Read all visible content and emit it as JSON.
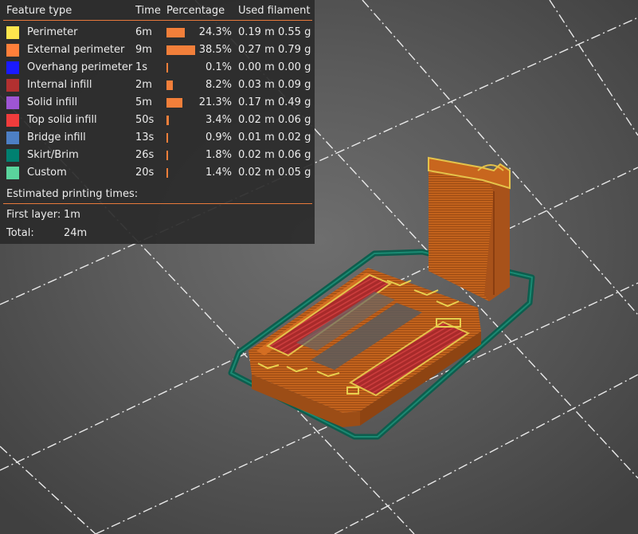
{
  "legend": {
    "headers": {
      "feature": "Feature type",
      "time": "Time",
      "percentage": "Percentage",
      "filament": "Used filament"
    },
    "rows": [
      {
        "label": "Perimeter",
        "color": "#ffe64d",
        "time": "6m",
        "percent": 24.3,
        "percent_text": "24.3%",
        "length": "0.19 m",
        "weight": "0.55 g"
      },
      {
        "label": "External perimeter",
        "color": "#ff7f3a",
        "time": "9m",
        "percent": 38.5,
        "percent_text": "38.5%",
        "length": "0.27 m",
        "weight": "0.79 g"
      },
      {
        "label": "Overhang perimeter",
        "color": "#1a1aff",
        "time": "1s",
        "percent": 0.1,
        "percent_text": "0.1%",
        "length": "0.00 m",
        "weight": "0.00 g"
      },
      {
        "label": "Internal infill",
        "color": "#b23030",
        "time": "2m",
        "percent": 8.2,
        "percent_text": "8.2%",
        "length": "0.03 m",
        "weight": "0.09 g"
      },
      {
        "label": "Solid infill",
        "color": "#9e55d4",
        "time": "5m",
        "percent": 21.3,
        "percent_text": "21.3%",
        "length": "0.17 m",
        "weight": "0.49 g"
      },
      {
        "label": "Top solid infill",
        "color": "#f03c3c",
        "time": "50s",
        "percent": 3.4,
        "percent_text": "3.4%",
        "length": "0.02 m",
        "weight": "0.06 g"
      },
      {
        "label": "Bridge infill",
        "color": "#4d7fc4",
        "time": "13s",
        "percent": 0.9,
        "percent_text": "0.9%",
        "length": "0.01 m",
        "weight": "0.02 g"
      },
      {
        "label": "Skirt/Brim",
        "color": "#008070",
        "time": "26s",
        "percent": 1.8,
        "percent_text": "1.8%",
        "length": "0.02 m",
        "weight": "0.06 g"
      },
      {
        "label": "Custom",
        "color": "#5ad49c",
        "time": "20s",
        "percent": 1.4,
        "percent_text": "1.4%",
        "length": "0.02 m",
        "weight": "0.05 g"
      }
    ],
    "estimated_title": "Estimated printing times:",
    "first_layer_label": "First layer:",
    "first_layer_value": "1m",
    "total_label": "Total:",
    "total_value": "24m"
  },
  "colors": {
    "accent": "#e8793b",
    "bar": "#f27f3a",
    "model": "#c0621c",
    "skirt": "#0f6e5a",
    "grid_line": "#f0f0f0"
  }
}
